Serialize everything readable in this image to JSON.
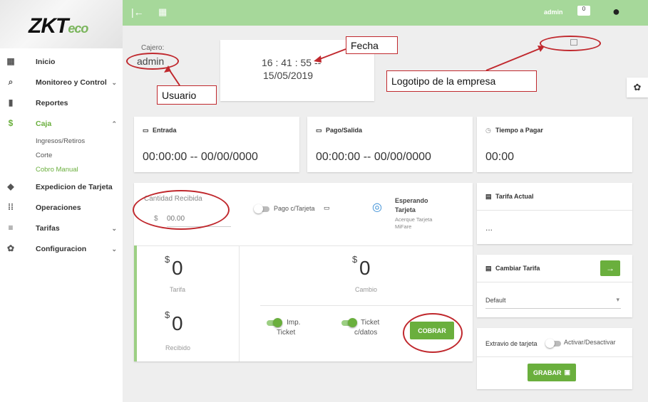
{
  "logo": {
    "brand": "ZKT",
    "suffix": "eco"
  },
  "nav": {
    "items": [
      {
        "label": "Inicio",
        "icon": "dashboard-icon",
        "chevron": ""
      },
      {
        "label": "Monitoreo y Control",
        "icon": "search-icon",
        "chevron": "⌄"
      },
      {
        "label": "Reportes",
        "icon": "document-icon",
        "chevron": ""
      },
      {
        "label": "Caja",
        "icon": "dollar-icon",
        "chevron": "⌃"
      },
      {
        "label": "Expedicion de Tarjeta",
        "icon": "tag-icon",
        "chevron": ""
      },
      {
        "label": "Operaciones",
        "icon": "grid-icon",
        "chevron": ""
      },
      {
        "label": "Tarifas",
        "icon": "list-icon",
        "chevron": "⌄"
      },
      {
        "label": "Configuracion",
        "icon": "gear-icon",
        "chevron": "⌄"
      }
    ],
    "sub": [
      "Ingresos/Retiros",
      "Corte",
      "Cobro Manual"
    ]
  },
  "topbar": {
    "user": "admin",
    "badge": "0"
  },
  "header": {
    "cashier_label": "Cajero:",
    "cashier": "admin",
    "time": "16 : 41 : 55 --",
    "date": "15/05/2019"
  },
  "annotations": {
    "fecha": "Fecha",
    "usuario": "Usuario",
    "logo": "Logotipo de la empresa"
  },
  "cards": {
    "entrada": {
      "title": "Entrada",
      "value": "00:00:00 -- 00/00/0000"
    },
    "pago": {
      "title": "Pago/Salida",
      "value": "00:00:00 -- 00/00/0000"
    },
    "tiempo": {
      "title": "Tiempo a Pagar",
      "value": "00:00"
    },
    "tarifa_actual": {
      "title": "Tarifa Actual",
      "value": "..."
    },
    "cambiar": {
      "title": "Cambiar Tarifa",
      "select": "Default"
    },
    "extravio": {
      "title": "Extravio de tarjeta",
      "toggle": "Activar/Desactivar",
      "button": "GRABAR"
    }
  },
  "payment": {
    "cantidad_label": "Cantidad Recibida",
    "currency": "$",
    "amount_placeholder": "00.00",
    "pago_tarjeta": "Pago c/Tarjeta",
    "esperando": "Esperando",
    "tarjeta": "Tarjeta",
    "acerque": "Acerque Tarjeta",
    "mifare": "MiFare",
    "dollar": "$",
    "tarifa_value": "0",
    "tarifa_label": "Tarifa",
    "recibido_value": "0",
    "recibido_label": "Recibido",
    "cambio_value": "0",
    "cambio_label": "Cambio",
    "imp_ticket_1": "Imp.",
    "imp_ticket_2": "Ticket",
    "ticket_datos_1": "Ticket",
    "ticket_datos_2": "c/datos",
    "cobrar": "COBRAR"
  }
}
